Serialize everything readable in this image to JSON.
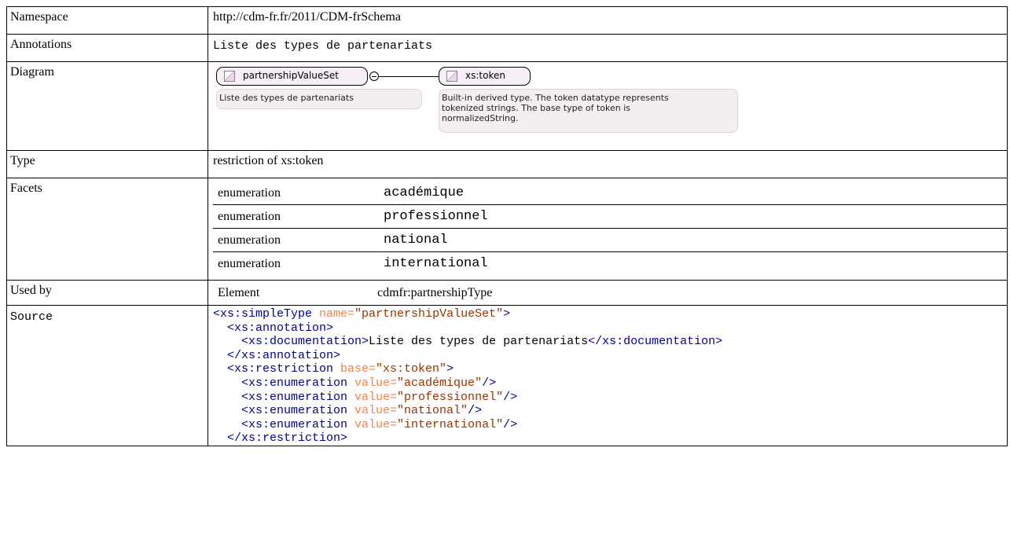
{
  "rows": {
    "namespace": {
      "label": "Namespace",
      "value": "http://cdm-fr.fr/2011/CDM-frSchema"
    },
    "annotations": {
      "label": "Annotations",
      "value": "Liste des types de partenariats"
    },
    "diagram": {
      "label": "Diagram",
      "node1_name": "partnershipValueSet",
      "node1_note": "Liste des types de partenariats",
      "node2_name": "xs:token",
      "node2_note_line1": "Built-in derived type. The token datatype represents",
      "node2_note_line2": "tokenized strings. The base type of token is",
      "node2_note_line3": "normalizedString.",
      "connector_icon": "collapse-minus-icon",
      "type_icon": "simple-type-triangle-icon"
    },
    "type": {
      "label": "Type",
      "value": "restriction of xs:token"
    },
    "facets": {
      "label": "Facets",
      "items": [
        {
          "kind": "enumeration",
          "value": "académique"
        },
        {
          "kind": "enumeration",
          "value": "professionnel"
        },
        {
          "kind": "enumeration",
          "value": "national"
        },
        {
          "kind": "enumeration",
          "value": "international"
        }
      ]
    },
    "used_by": {
      "label": "Used by",
      "kind": "Element",
      "value": "cdmfr:partnershipType"
    },
    "source": {
      "label": "Source",
      "line1_tag": "<xs:simpleType",
      "line1_attr": " name=",
      "line1_val": "\"partnershipValueSet\"",
      "line1_end": ">",
      "line2": "  <xs:annotation>",
      "line3_open": "    <xs:documentation>",
      "line3_text": "Liste des types de partenariats",
      "line3_close": "</xs:documentation>",
      "line4": "  </xs:annotation>",
      "line5_tag": "  <xs:restriction",
      "line5_attr": " base=",
      "line5_val": "\"xs:token\"",
      "line5_end": ">",
      "enum_tag": "    <xs:enumeration",
      "enum_attr": " value=",
      "enum_end": "/>",
      "enum_vals": [
        "\"académique\"",
        "\"professionnel\"",
        "\"national\"",
        "\"international\""
      ],
      "line10": "  </xs:restriction>"
    }
  },
  "colors": {
    "tag": "#000096",
    "attr_name": "#f5844c",
    "attr_value": "#993300"
  }
}
